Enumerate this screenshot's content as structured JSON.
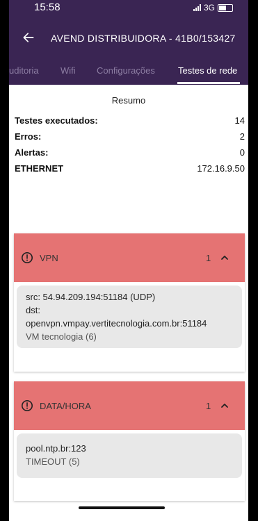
{
  "status_bar": {
    "time": "15:58",
    "network": "3G"
  },
  "app_bar": {
    "title": "AVEND DISTRIBUIDORA - 41B0/153427"
  },
  "tabs": [
    {
      "label": "uditoria",
      "active": false
    },
    {
      "label": "Wifi",
      "active": false
    },
    {
      "label": "Configurações",
      "active": false
    },
    {
      "label": "Testes de rede",
      "active": true
    }
  ],
  "summary": {
    "title": "Resumo",
    "rows": [
      {
        "key": "Testes executados:",
        "value": "14"
      },
      {
        "key": "Erros:",
        "value": "2"
      },
      {
        "key": "Alertas:",
        "value": "0"
      },
      {
        "key": "ETHERNET",
        "value": "172.16.9.50"
      }
    ]
  },
  "results": [
    {
      "name": "VPN",
      "count": "1",
      "lines": [
        "src: 54.94.209.194:51184 (UDP)",
        "dst:",
        "openvpn.vmpay.vertitecnologia.com.br:51184"
      ],
      "status": "VM tecnologia (6)"
    },
    {
      "name": "DATA/HORA",
      "count": "1",
      "lines": [
        "pool.ntp.br:123"
      ],
      "status": "TIMEOUT (5)"
    }
  ],
  "colors": {
    "primary": "#3a2553",
    "error_header": "#e57373",
    "result_box": "#e8e8e8",
    "inactive_tab": "#8d7ea3"
  },
  "icons": [
    "back-arrow-icon",
    "error-circle-icon",
    "chevron-up-icon",
    "signal-icon",
    "battery-icon"
  ]
}
